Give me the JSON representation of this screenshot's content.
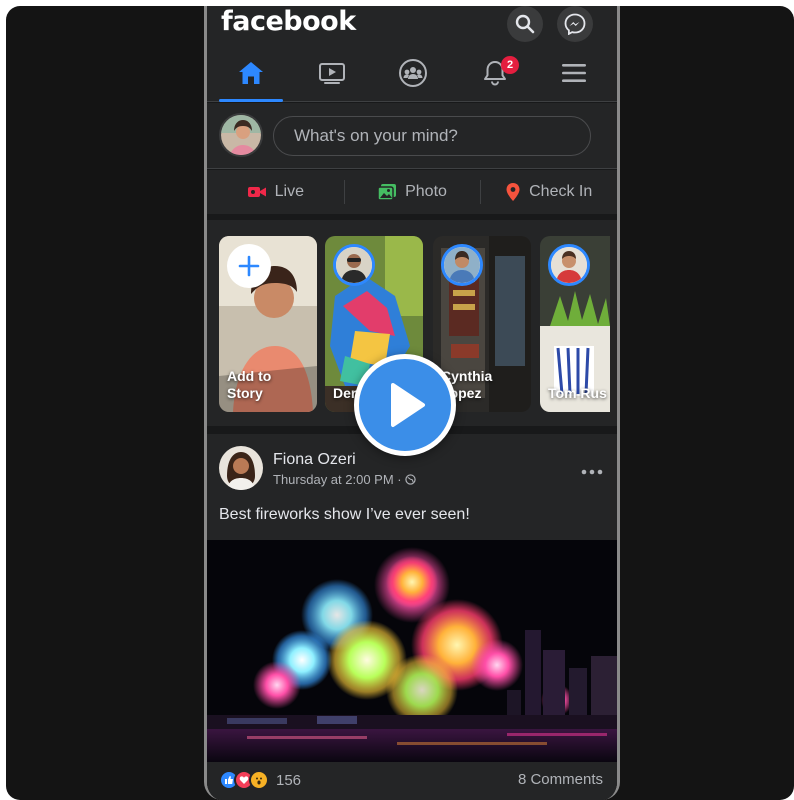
{
  "header": {
    "logo_text": "facebook",
    "search_icon": "search-icon",
    "messenger_icon": "messenger-icon"
  },
  "nav": {
    "items": [
      {
        "name": "home",
        "icon": "home-icon",
        "active": true
      },
      {
        "name": "watch",
        "icon": "video-icon",
        "active": false
      },
      {
        "name": "groups",
        "icon": "groups-icon",
        "active": false
      },
      {
        "name": "notifications",
        "icon": "bell-icon",
        "active": false,
        "badge": "2"
      },
      {
        "name": "menu",
        "icon": "hamburger-icon",
        "active": false
      }
    ],
    "notification_badge": "2"
  },
  "composer": {
    "placeholder": "What's on your mind?"
  },
  "actions": {
    "live_label": "Live",
    "photo_label": "Photo",
    "checkin_label": "Check In"
  },
  "stories": [
    {
      "label": "Add to Story"
    },
    {
      "label": "Der"
    },
    {
      "label": "Cynthia Lopez"
    },
    {
      "label": "Tom Rus"
    }
  ],
  "post": {
    "author": "Fiona Ozeri",
    "time": "Thursday at 2:00 PM · ",
    "text": "Best fireworks show I’ve ever seen!",
    "reaction_count": "156",
    "comments": "8 Comments"
  },
  "colors": {
    "accent": "#2d88ff",
    "background": "#18191a",
    "surface": "#242526",
    "badge": "#e41e3f"
  }
}
